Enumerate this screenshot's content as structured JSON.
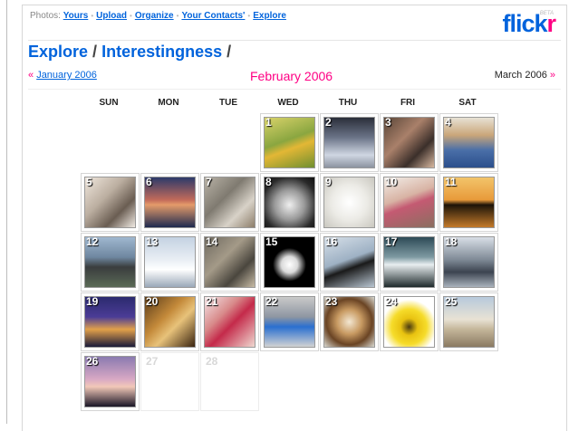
{
  "topnav": {
    "prefix": "Photos:",
    "links": [
      "Yours",
      "Upload",
      "Organize",
      "Your Contacts'",
      "Explore"
    ]
  },
  "logo": {
    "part1": "flick",
    "part2": "r",
    "badge": "BETA"
  },
  "heading": {
    "explore": "Explore",
    "interestingness": "Interestingness",
    "separator": "/"
  },
  "months": {
    "prev_arrow": "«",
    "prev": "January 2006",
    "current": "February 2006",
    "next": "March 2006",
    "next_arrow": "»"
  },
  "weekdays": [
    "SUN",
    "MON",
    "TUE",
    "WED",
    "THU",
    "FRI",
    "SAT"
  ],
  "days": [
    {
      "n": "1",
      "photo": true
    },
    {
      "n": "2",
      "photo": true
    },
    {
      "n": "3",
      "photo": true
    },
    {
      "n": "4",
      "photo": true
    },
    {
      "n": "5",
      "photo": true
    },
    {
      "n": "6",
      "photo": true
    },
    {
      "n": "7",
      "photo": true
    },
    {
      "n": "8",
      "photo": true
    },
    {
      "n": "9",
      "photo": true
    },
    {
      "n": "10",
      "photo": true
    },
    {
      "n": "11",
      "photo": true
    },
    {
      "n": "12",
      "photo": true
    },
    {
      "n": "13",
      "photo": true
    },
    {
      "n": "14",
      "photo": true
    },
    {
      "n": "15",
      "photo": true
    },
    {
      "n": "16",
      "photo": true
    },
    {
      "n": "17",
      "photo": true
    },
    {
      "n": "18",
      "photo": true
    },
    {
      "n": "19",
      "photo": true
    },
    {
      "n": "20",
      "photo": true
    },
    {
      "n": "21",
      "photo": true
    },
    {
      "n": "22",
      "photo": true
    },
    {
      "n": "23",
      "photo": true
    },
    {
      "n": "24",
      "photo": true
    },
    {
      "n": "25",
      "photo": true
    },
    {
      "n": "26",
      "photo": true
    },
    {
      "n": "27",
      "photo": false
    },
    {
      "n": "28",
      "photo": false
    }
  ],
  "colors": {
    "link_blue": "#0063dc",
    "flickr_pink": "#ff0084"
  }
}
